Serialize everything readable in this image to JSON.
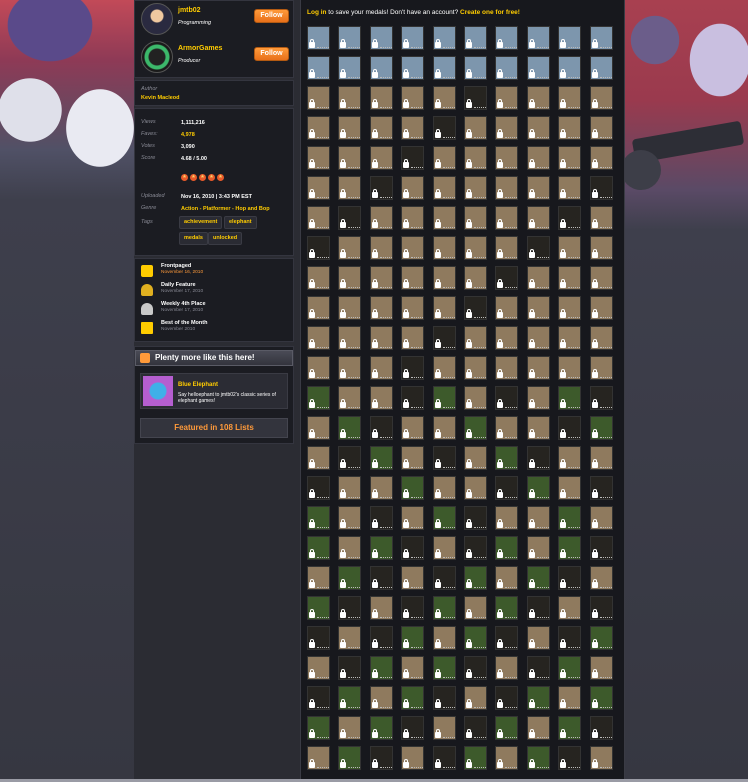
{
  "credits": [
    {
      "name": "jmtb02",
      "role": "Programming",
      "follow_label": "Follow"
    },
    {
      "name": "ArmorGames",
      "role": "Producer",
      "follow_label": "Follow"
    }
  ],
  "author": {
    "label": "Author",
    "name": "Kevin Macleod"
  },
  "stats": {
    "views_label": "Views",
    "views": "1,111,216",
    "faves_label": "Faves:",
    "faves": "4,978",
    "votes_label": "Votes",
    "votes": "3,090",
    "score_label": "Score",
    "score": "4.68 / 5.00",
    "stars": 5
  },
  "info": {
    "uploaded_label": "Uploaded",
    "uploaded": "Nov 16, 2010  |  3:43 PM EST",
    "genre_label": "Genre",
    "genre": "Action - Platformer - Hop and Bop",
    "tags_label": "Tags",
    "tags": [
      "achievement",
      "elephant",
      "medals",
      "unlocked"
    ]
  },
  "awards": [
    {
      "title": "Frontpaged",
      "date": "November 16, 2010",
      "highlight": true
    },
    {
      "title": "Daily Feature",
      "date": "November 17, 2010",
      "highlight": false
    },
    {
      "title": "Weekly 4th Place",
      "date": "November 17, 2010",
      "highlight": false
    },
    {
      "title": "Best of the Month",
      "date": "November 2010",
      "highlight": false
    }
  ],
  "more": {
    "header": "Plenty more like this here!",
    "featured_title": "Blue Elephant",
    "featured_desc": "Say helloephant to jmtb02's classic series of elephant games!",
    "lists_label": "Featured in 108 Lists"
  },
  "medals": {
    "login_link": "Log in",
    "login_text": " to save your medals! Don't have an account? ",
    "create_link": "Create one for free!",
    "rows": 25,
    "cols": 10,
    "locked": true,
    "colors": {
      "sky": "#7d96ad",
      "sand": "#8f7a5e",
      "dark": "#262420",
      "grass": "#3d5a2b"
    }
  },
  "colors": {
    "accent": "#ffcc00",
    "button": "#f0801e",
    "panel": "#1b1c22"
  }
}
